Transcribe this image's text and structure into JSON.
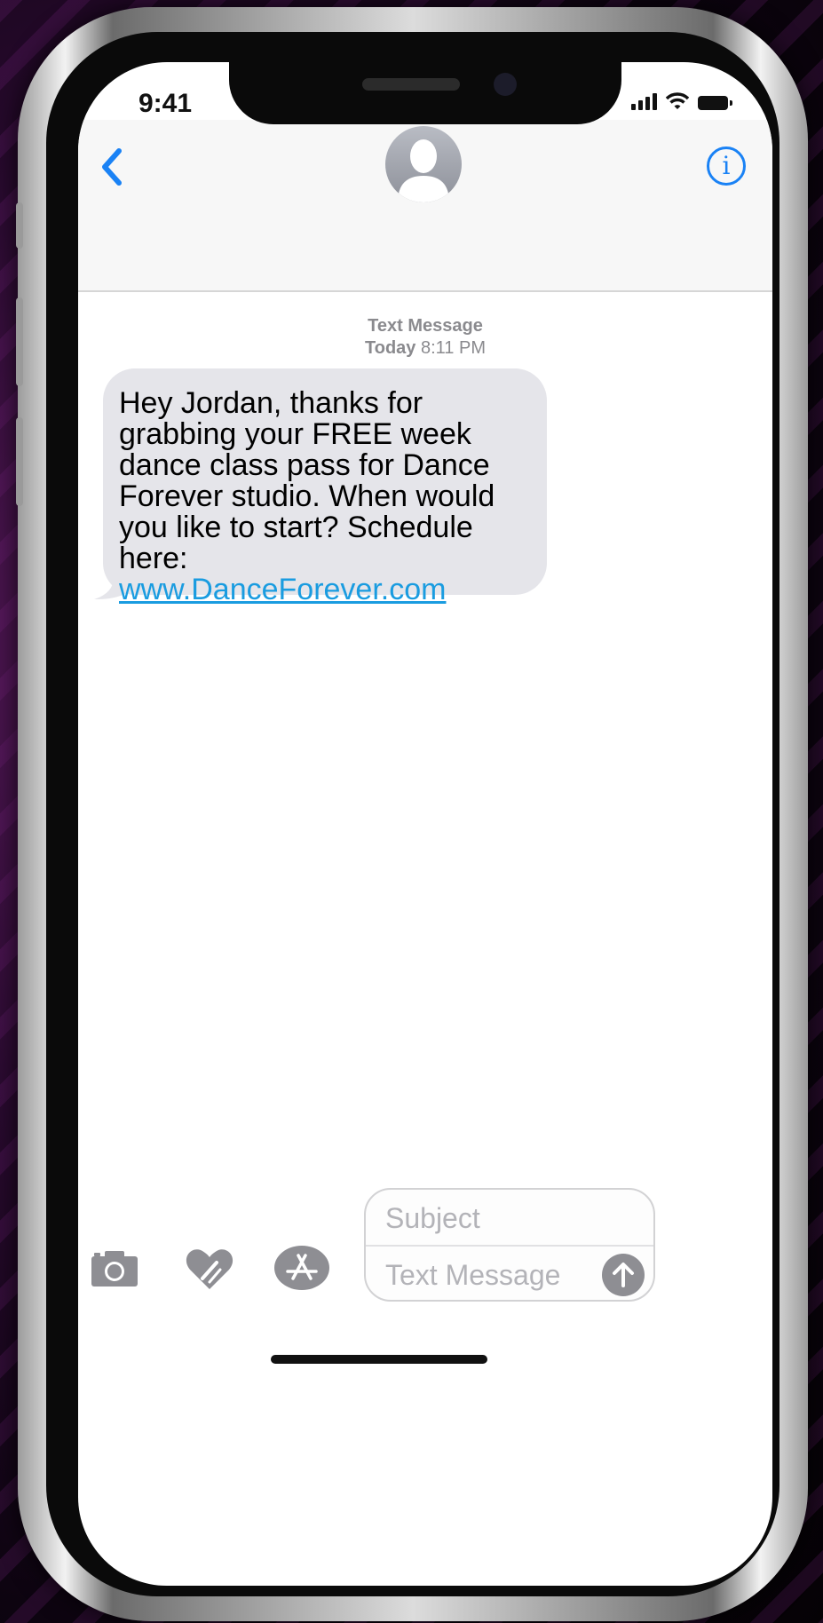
{
  "status_bar": {
    "time": "9:41"
  },
  "nav": {
    "back_icon": "chevron-left-icon",
    "avatar_icon": "person-avatar-icon",
    "info_icon": "info-icon",
    "info_glyph": "i"
  },
  "conversation": {
    "header_service": "Text Message",
    "header_day": "Today",
    "header_time": "8:11 PM",
    "message": {
      "text": "Hey Jordan, thanks for grabbing your FREE week dance class pass for Dance Forever studio. When would you like to start? Schedule here:",
      "link": "www.DanceForever.com"
    }
  },
  "composer": {
    "subject_placeholder": "Subject",
    "text_placeholder": "Text Message"
  },
  "colors": {
    "accent": "#1a82f5",
    "link": "#1a9ce0",
    "bubble": "#e5e5ea"
  }
}
